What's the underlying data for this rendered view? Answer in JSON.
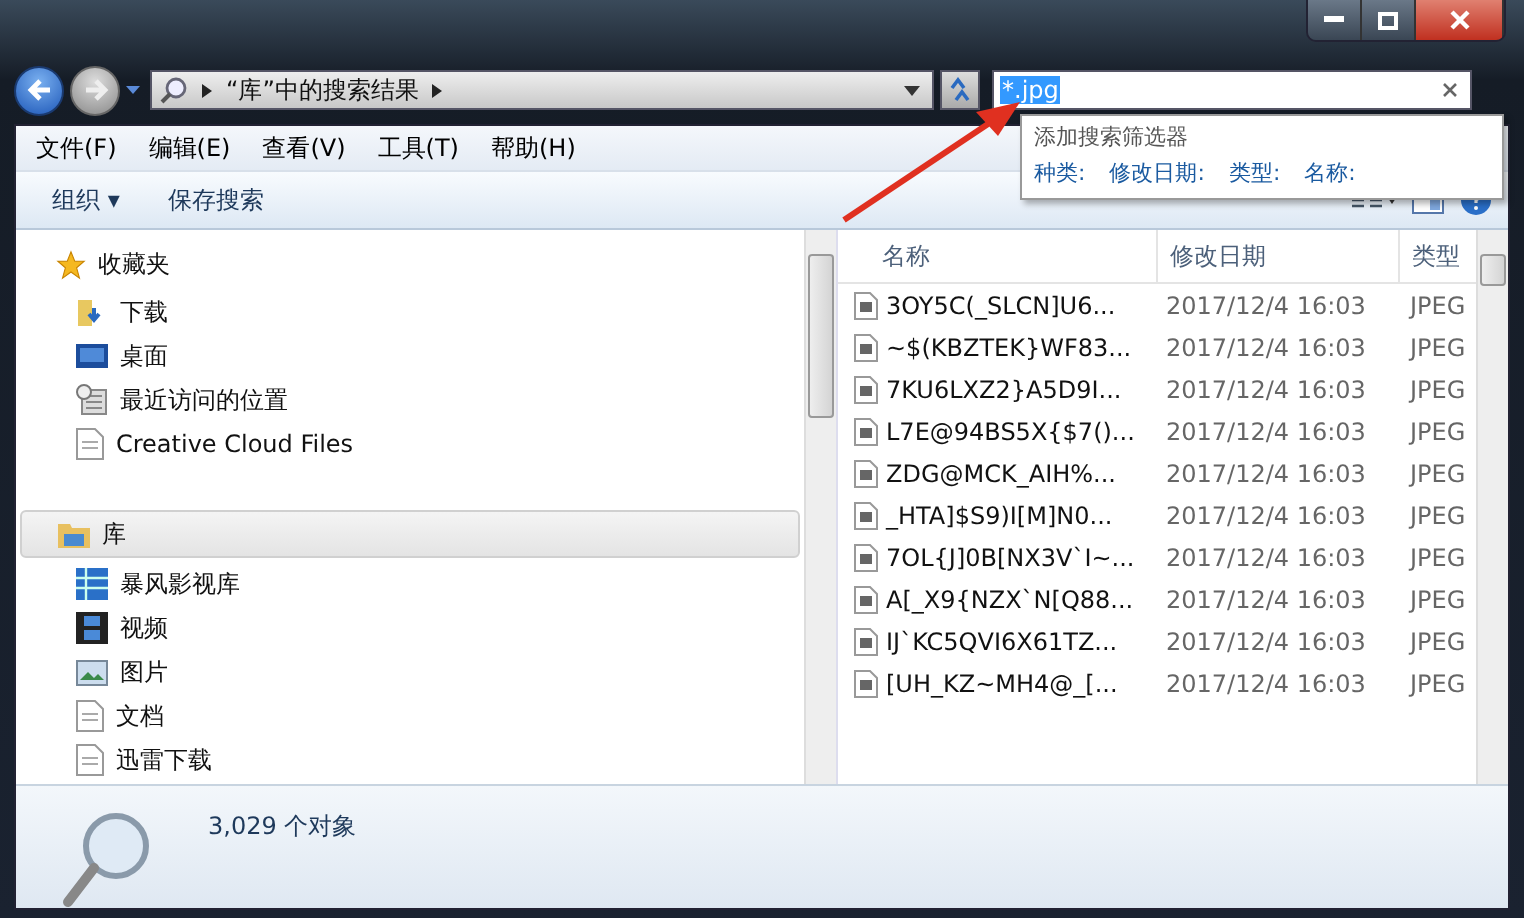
{
  "address": {
    "crumbs": [
      "“库”中的搜索结果"
    ]
  },
  "search": {
    "value": "*.jpg",
    "filter_title": "添加搜索筛选器",
    "filters": [
      "种类:",
      "修改日期:",
      "类型:",
      "名称:"
    ]
  },
  "menu": [
    "文件(F)",
    "编辑(E)",
    "查看(V)",
    "工具(T)",
    "帮助(H)"
  ],
  "toolbar": {
    "organize": "组织 ▾",
    "save_search": "保存搜索"
  },
  "nav": [
    {
      "label": "收藏夹",
      "selected": false,
      "children": [
        "下载",
        "桌面",
        "最近访问的位置",
        "Creative Cloud Files"
      ]
    },
    {
      "label": "库",
      "selected": true,
      "children": [
        "暴风影视库",
        "视频",
        "图片",
        "文档",
        "迅雷下载"
      ]
    }
  ],
  "table": {
    "columns": [
      "名称",
      "修改日期",
      "类型"
    ],
    "rows": [
      [
        "3OY5C(_SLCN]U6...",
        "2017/12/4 16:03",
        "JPEG"
      ],
      [
        "~$(KBZTEK}WF83...",
        "2017/12/4 16:03",
        "JPEG"
      ],
      [
        "7KU6LXZ2}A5D9I...",
        "2017/12/4 16:03",
        "JPEG"
      ],
      [
        "L7E@94BS5X{$7()...",
        "2017/12/4 16:03",
        "JPEG"
      ],
      [
        "ZDG@MCK_AIH%...",
        "2017/12/4 16:03",
        "JPEG"
      ],
      [
        "_HTA]$S9)I[M]N0...",
        "2017/12/4 16:03",
        "JPEG"
      ],
      [
        "7OL{J]0B[NX3V`I~...",
        "2017/12/4 16:03",
        "JPEG"
      ],
      [
        "A[_X9{NZX`N[Q88...",
        "2017/12/4 16:03",
        "JPEG"
      ],
      [
        "IJ`KC5QVI6X61TZ...",
        "2017/12/4 16:03",
        "JPEG"
      ],
      [
        "[UH_KZ~MH4@_[...",
        "2017/12/4 16:03",
        "JPEG"
      ]
    ]
  },
  "status_bar": {
    "count": "3,029 个对象"
  }
}
